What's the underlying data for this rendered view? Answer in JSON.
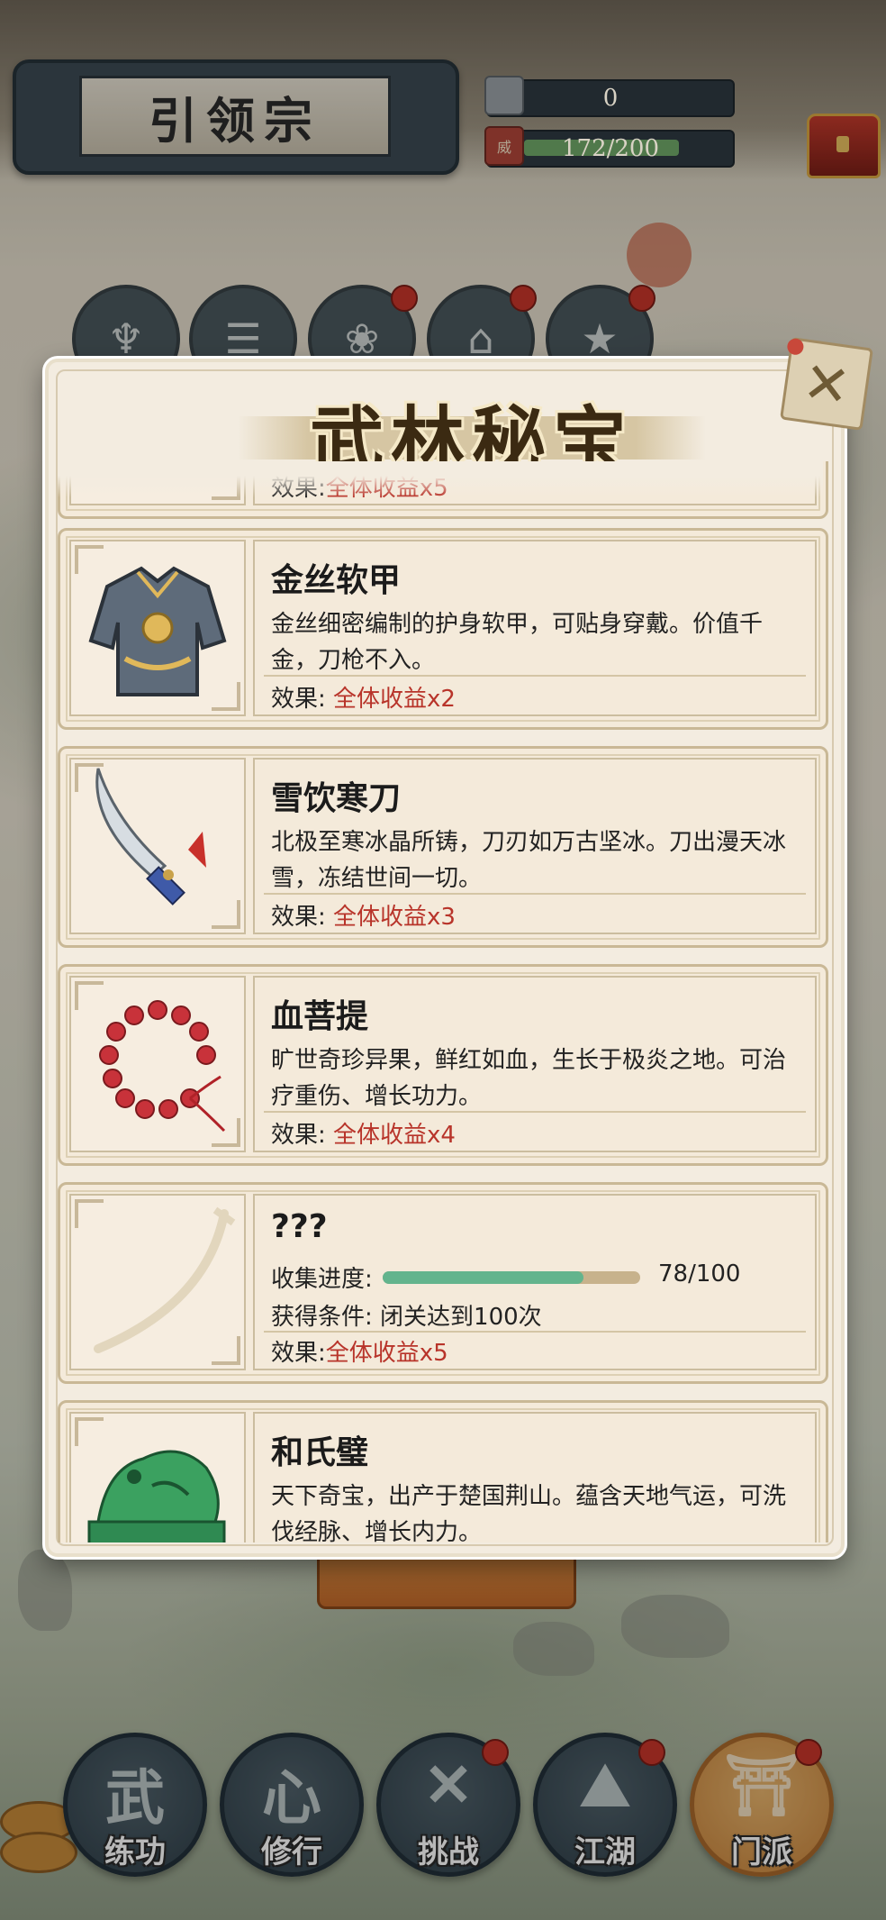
{
  "header": {
    "sect_title": "引领宗",
    "silver_value": "0",
    "power_value": "172/200",
    "power_icon_text": "威",
    "power_fraction": 0.86
  },
  "top_icons": [
    {
      "icon": "bag-icon",
      "glyph": "♆",
      "badge": false
    },
    {
      "icon": "scroll-icon",
      "glyph": "☰",
      "badge": false
    },
    {
      "icon": "lotus-icon",
      "glyph": "❀",
      "badge": true
    },
    {
      "icon": "pavilion-icon",
      "glyph": "⌂",
      "badge": true
    },
    {
      "icon": "runner-icon",
      "glyph": "★",
      "badge": true
    }
  ],
  "modal": {
    "title": "武林秘宝",
    "close_glyph": "✕",
    "partial_top_effect_label": "效果:",
    "partial_top_effect_value": "全体收益x5",
    "items": [
      {
        "id": "golden-armor",
        "icon": "armor-icon",
        "name": "金丝软甲",
        "desc": "金丝细密编制的护身软甲，可贴身穿戴。价值千金，刀枪不入。",
        "effect_label": "效果:",
        "effect_value": "全体收益x2"
      },
      {
        "id": "snow-blade",
        "icon": "saber-icon",
        "name": "雪饮寒刀",
        "desc": "北极至寒冰晶所铸，刀刃如万古坚冰。刀出漫天冰雪，冻结世间一切。",
        "effect_label": "效果:",
        "effect_value": "全体收益x3"
      },
      {
        "id": "blood-bodhi",
        "icon": "bead-bracelet-icon",
        "name": "血菩提",
        "desc": "旷世奇珍异果，鲜红如血，生长于极炎之地。可治疗重伤、增长功力。",
        "effect_label": "效果:",
        "effect_value": "全体收益x4"
      },
      {
        "id": "unknown-treasure",
        "icon": "locked-silhouette-icon",
        "name": "???",
        "progress_label": "收集进度:",
        "progress_current": 78,
        "progress_total": 100,
        "progress_text": "78/100",
        "condition": "获得条件: 闭关达到100次",
        "effect_label": "效果:",
        "effect_value": "全体收益x5"
      },
      {
        "id": "heshi-bi",
        "icon": "jade-seal-icon",
        "name": "和氏璧",
        "desc": "天下奇宝，出产于楚国荆山。蕴含天地气运，可洗伐经脉、增长内力。"
      }
    ]
  },
  "behind_button_label": "",
  "bottom_nav": [
    {
      "label": "练功",
      "glyph": "武",
      "icon": "martial-arts-icon",
      "badge": false,
      "active": false
    },
    {
      "label": "修行",
      "glyph": "心",
      "icon": "heart-mind-icon",
      "badge": false,
      "active": false
    },
    {
      "label": "挑战",
      "glyph": "✕",
      "icon": "crossed-swords-icon",
      "badge": true,
      "active": false
    },
    {
      "label": "江湖",
      "glyph": "⛰",
      "icon": "mountains-icon",
      "badge": true,
      "active": false
    },
    {
      "label": "门派",
      "glyph": "⛩",
      "icon": "gate-icon",
      "badge": true,
      "active": true
    }
  ]
}
